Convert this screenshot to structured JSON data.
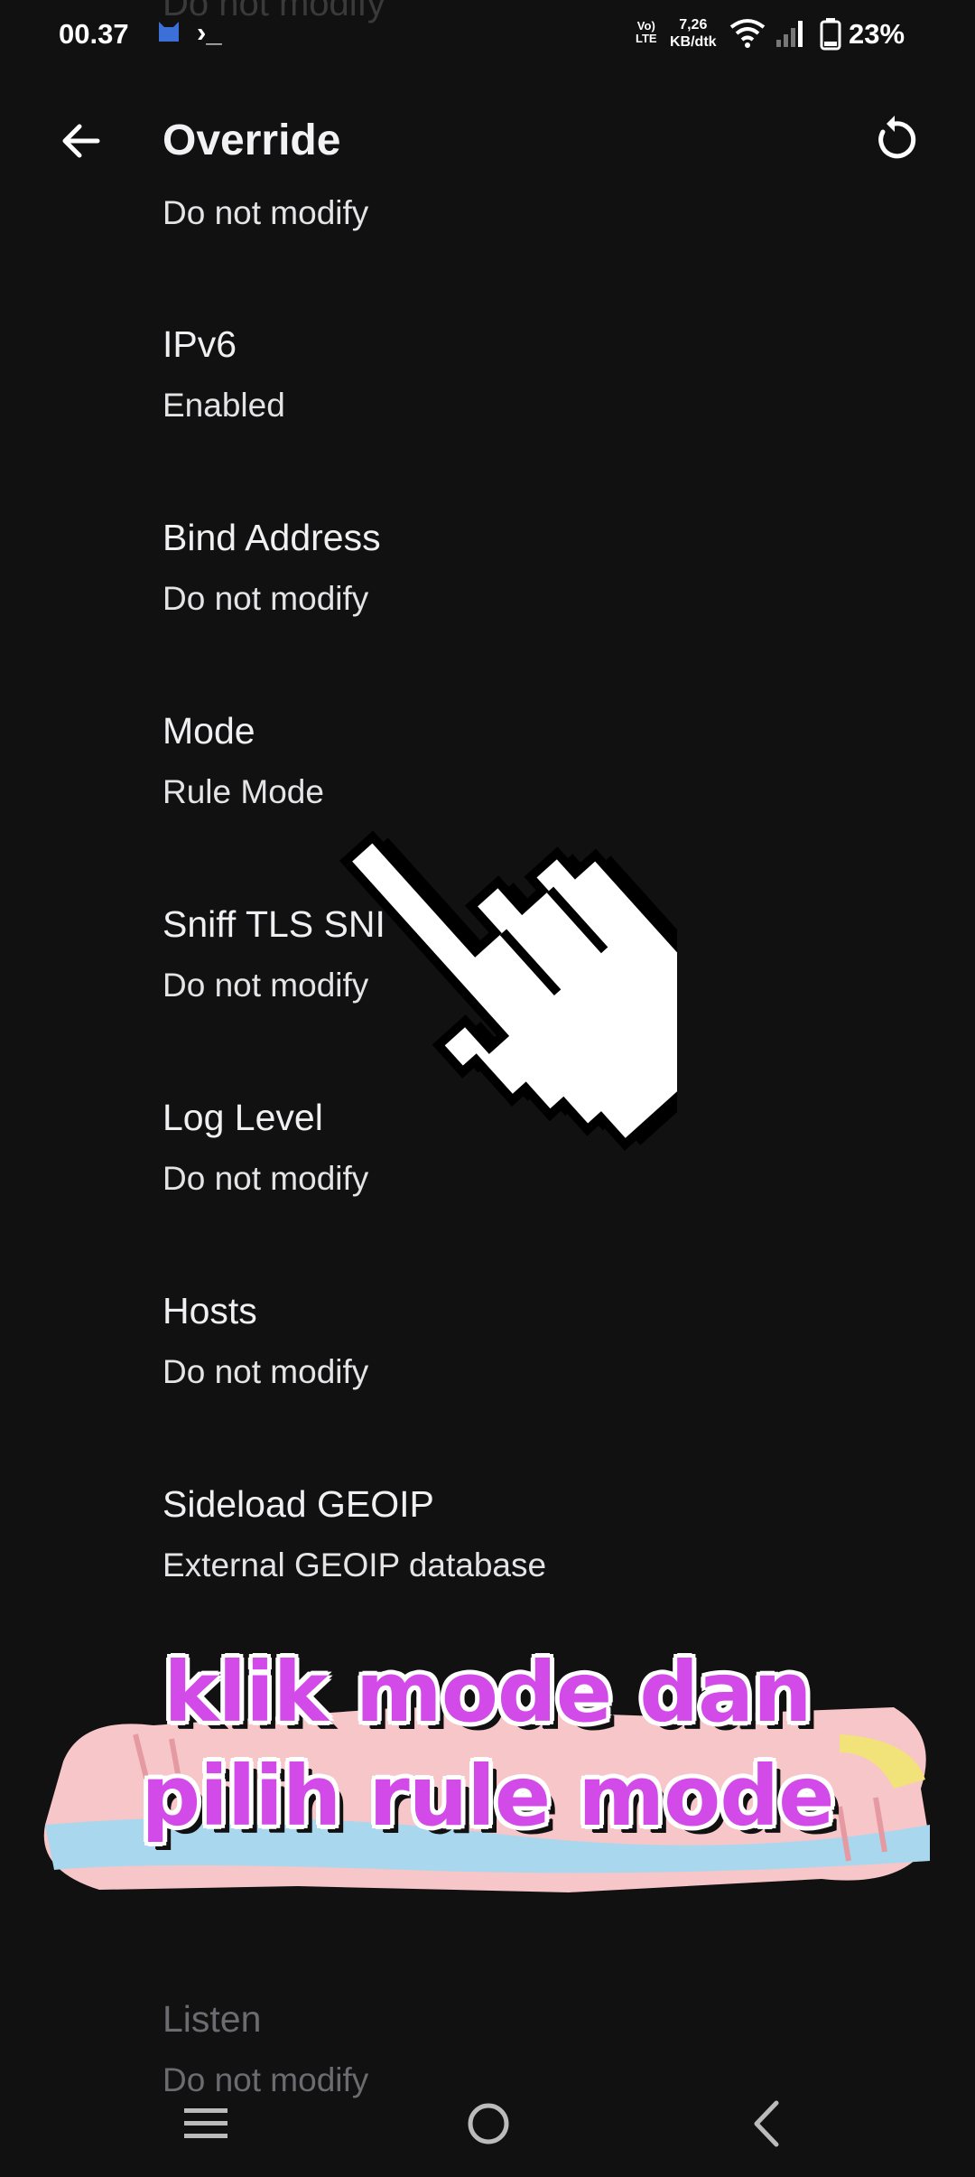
{
  "status_bar": {
    "time": "00.37",
    "terminal_glyph": "›_",
    "network_type_top": "Vo)",
    "network_type_bottom": "LTE",
    "speed_value": "7,26",
    "speed_unit": "KB/dtk",
    "battery": "23%"
  },
  "header_ghost": "Do not modify",
  "appbar": {
    "title": "Override"
  },
  "partial_top_value": "Do not modify",
  "items": [
    {
      "label": "IPv6",
      "value": "Enabled"
    },
    {
      "label": "Bind Address",
      "value": "Do not modify"
    },
    {
      "label": "Mode",
      "value": "Rule Mode"
    },
    {
      "label": "Sniff TLS SNI",
      "value": "Do not modify"
    },
    {
      "label": "Log Level",
      "value": "Do not modify"
    },
    {
      "label": "Hosts",
      "value": "Do not modify"
    },
    {
      "label": "Sideload GEOIP",
      "value": "External GEOIP database"
    },
    {
      "label": "Listen",
      "value": "Do not modify"
    }
  ],
  "caption": {
    "line1": "klik mode dan",
    "line2": "pilih rule mode"
  },
  "colors": {
    "background": "#111112",
    "caption_text": "#d24be8",
    "brush_pink": "#f6c6c9",
    "brush_blue": "#a9d7ee",
    "brush_yellow": "#f2e27a"
  }
}
